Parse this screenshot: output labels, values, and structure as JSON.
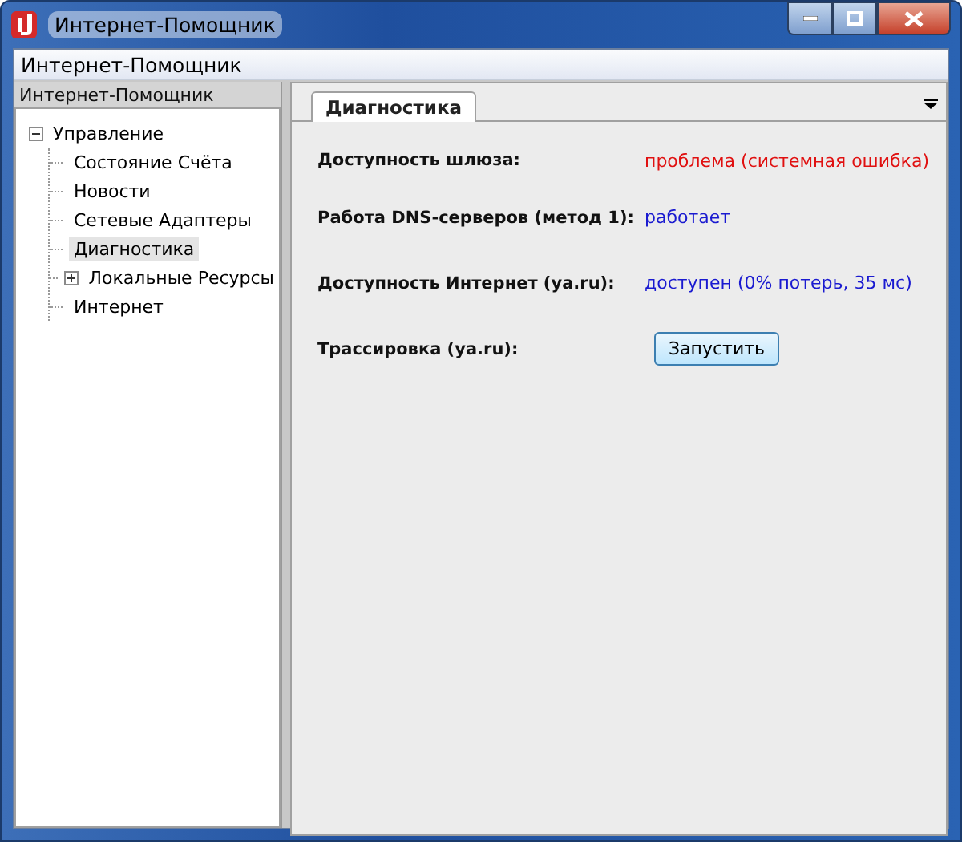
{
  "window": {
    "title": "Интернет-Помощник"
  },
  "menu_bar": {
    "title": "Интернет-Помощник"
  },
  "sidebar": {
    "title": "Интернет-Помощник",
    "tree": [
      {
        "label": "Управление",
        "expanded": true,
        "selected": false,
        "children": [
          {
            "label": "Состояние Счёта",
            "selected": false
          },
          {
            "label": "Новости",
            "selected": false
          },
          {
            "label": "Сетевые Адаптеры",
            "selected": false
          },
          {
            "label": "Диагностика",
            "selected": true
          },
          {
            "label": "Локальные Ресурсы",
            "expanded": false,
            "selected": false
          },
          {
            "label": "Интернет",
            "selected": false
          }
        ]
      }
    ]
  },
  "tabs": [
    {
      "label": "Диагностика",
      "selected": true
    }
  ],
  "rows": [
    {
      "kind": "status",
      "label": "Доступность шлюза:",
      "value": "проблема (системная ошибка)",
      "color": "#e01010"
    },
    {
      "kind": "status",
      "label": "Работа DNS-серверов (метод 1):",
      "value": "работает",
      "color": "#1a1ad0"
    },
    {
      "kind": "status",
      "label": "Доступность Интернет (ya.ru):",
      "value": "доступен (0% потерь, 35 мс)",
      "color": "#1a1ad0"
    },
    {
      "kind": "action",
      "label": "Трассировка (ya.ru):",
      "button": "Запустить"
    }
  ]
}
